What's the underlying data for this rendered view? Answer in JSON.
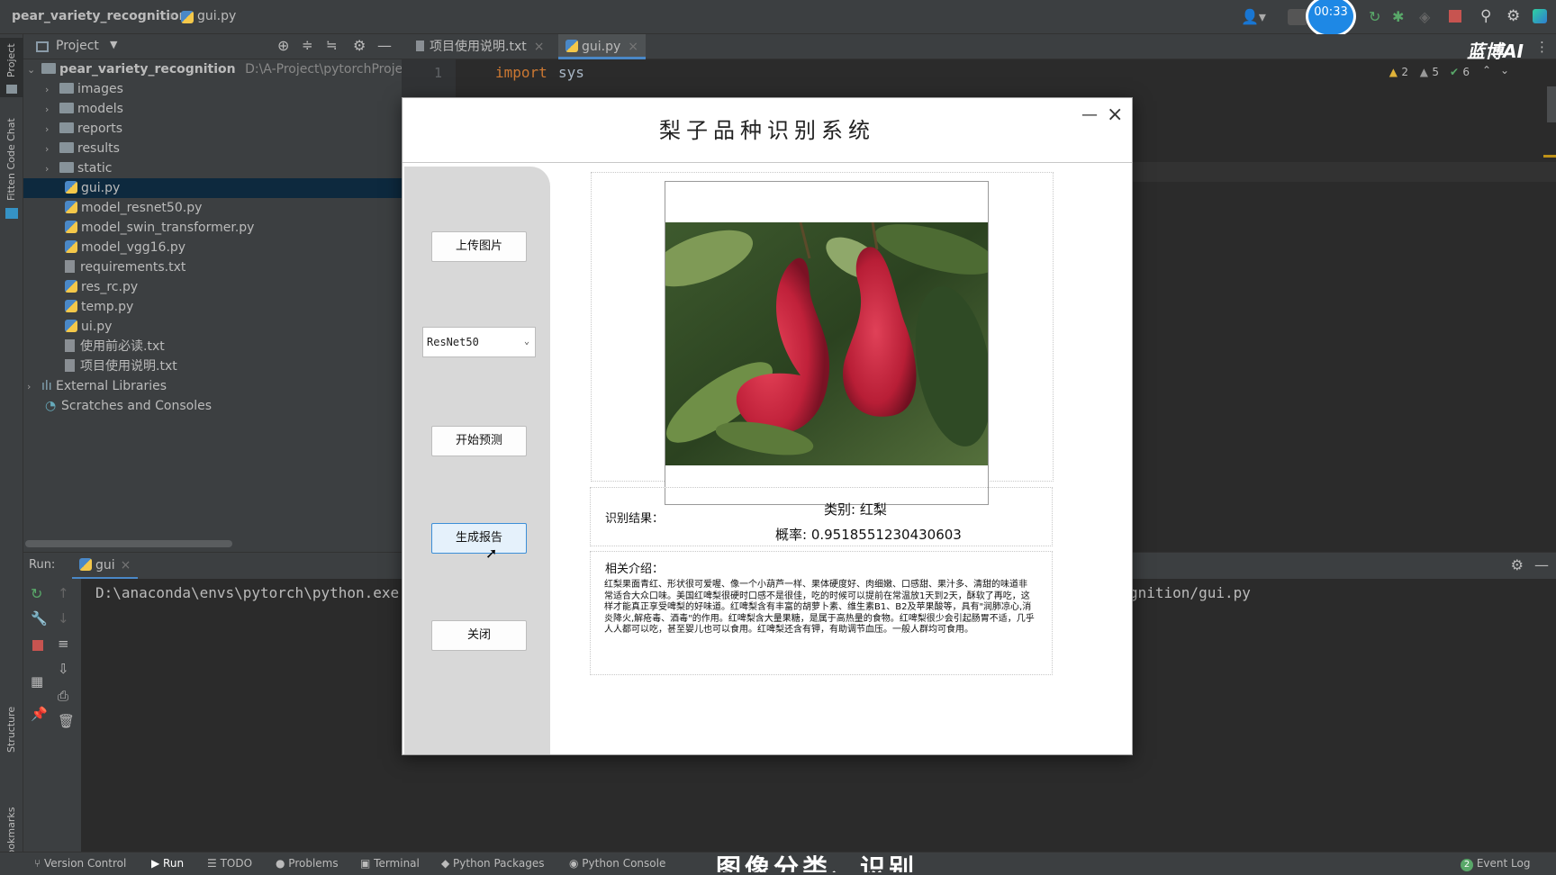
{
  "topbar": {
    "project": "pear_variety_recognition",
    "file": "gui.py",
    "timer": "00:33",
    "brand": "蓝博AI"
  },
  "left_stripe": {
    "project": "Project",
    "fitten": "Fitten Code Chat",
    "structure": "Structure",
    "bookmarks": "Bookmarks"
  },
  "project_panel": {
    "title": "Project",
    "root": "pear_variety_recognition",
    "root_path": "D:\\A-Project\\pytorchProject\\cla",
    "items": [
      {
        "label": "images",
        "type": "folder"
      },
      {
        "label": "models",
        "type": "folder"
      },
      {
        "label": "reports",
        "type": "folder"
      },
      {
        "label": "results",
        "type": "folder"
      },
      {
        "label": "static",
        "type": "folder"
      },
      {
        "label": "gui.py",
        "type": "py"
      },
      {
        "label": "model_resnet50.py",
        "type": "py"
      },
      {
        "label": "model_swin_transformer.py",
        "type": "py"
      },
      {
        "label": "model_vgg16.py",
        "type": "py"
      },
      {
        "label": "requirements.txt",
        "type": "txt"
      },
      {
        "label": "res_rc.py",
        "type": "py"
      },
      {
        "label": "temp.py",
        "type": "py"
      },
      {
        "label": "ui.py",
        "type": "py"
      },
      {
        "label": "使用前必读.txt",
        "type": "txt"
      },
      {
        "label": "项目使用说明.txt",
        "type": "txt"
      }
    ],
    "external": "External Libraries",
    "scratches": "Scratches and Consoles"
  },
  "editor": {
    "tabs": [
      {
        "label": "项目使用说明.txt"
      },
      {
        "label": "gui.py"
      }
    ],
    "line1_num": "1",
    "line1_kw": "import",
    "line1_mod": "sys",
    "inspections": {
      "warn1": "2",
      "warn2": "5",
      "ok": "6"
    }
  },
  "run": {
    "label": "Run:",
    "config": "gui",
    "command_start": "D:\\anaconda\\envs\\pytorch\\python.exe",
    "command_end": "gnition/gui.py"
  },
  "bottom_bar": {
    "items": [
      "Version Control",
      "Run",
      "TODO",
      "Problems",
      "Terminal",
      "Python Packages",
      "Python Console"
    ],
    "overlay_text": "图像分类、识别",
    "event_log": "Event Log",
    "event_count": "2"
  },
  "dialog": {
    "title": "梨子品种识别系统",
    "upload_button": "上传图片",
    "model_select": "ResNet50",
    "predict_button": "开始预测",
    "report_button": "生成报告",
    "close_button": "关闭",
    "result_label": "识别结果：",
    "category": "类别: 红梨",
    "probability": "概率: 0.9518551230430603",
    "intro_label": "相关介绍：",
    "intro_text": "红梨果面青红、形状很可爱喔、像一个小葫芦一样、果体硬度好、肉细嫩、口感甜、果汁多、清甜的味道非常适合大众口味。美国红啤梨很硬时口感不是很佳，吃的时候可以提前在常温放1天到2天，酥软了再吃，这样才能真正享受啤梨的好味道。红啤梨含有丰富的胡萝卜素、维生素B1、B2及苹果酸等，具有\"润肺凉心,消炎降火,解疮毒、酒毒\"的作用。红啤梨含大量果糖，是属于高热量的食物。红啤梨很少会引起肠胃不适，几乎人人都可以吃，甚至婴儿也可以食用。红啤梨还含有钾，有助调节血压。一般人群均可食用。"
  }
}
